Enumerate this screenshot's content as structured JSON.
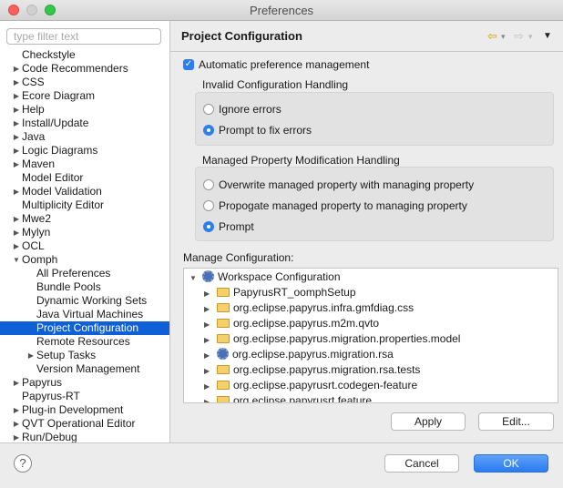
{
  "window": {
    "title": "Preferences"
  },
  "filter": {
    "placeholder": "type filter text",
    "value": ""
  },
  "tree": [
    {
      "label": "Checkstyle",
      "expandable": false,
      "level": 0
    },
    {
      "label": "Code Recommenders",
      "expandable": true,
      "level": 0
    },
    {
      "label": "CSS",
      "expandable": true,
      "level": 0
    },
    {
      "label": "Ecore Diagram",
      "expandable": true,
      "level": 0
    },
    {
      "label": "Help",
      "expandable": true,
      "level": 0
    },
    {
      "label": "Install/Update",
      "expandable": true,
      "level": 0
    },
    {
      "label": "Java",
      "expandable": true,
      "level": 0
    },
    {
      "label": "Logic Diagrams",
      "expandable": true,
      "level": 0
    },
    {
      "label": "Maven",
      "expandable": true,
      "level": 0
    },
    {
      "label": "Model Editor",
      "expandable": false,
      "level": 0
    },
    {
      "label": "Model Validation",
      "expandable": true,
      "level": 0
    },
    {
      "label": "Multiplicity Editor",
      "expandable": false,
      "level": 0
    },
    {
      "label": "Mwe2",
      "expandable": true,
      "level": 0
    },
    {
      "label": "Mylyn",
      "expandable": true,
      "level": 0
    },
    {
      "label": "OCL",
      "expandable": true,
      "level": 0
    },
    {
      "label": "Oomph",
      "expandable": true,
      "expanded": true,
      "level": 0
    },
    {
      "label": "All Preferences",
      "expandable": false,
      "level": 1
    },
    {
      "label": "Bundle Pools",
      "expandable": false,
      "level": 1
    },
    {
      "label": "Dynamic Working Sets",
      "expandable": false,
      "level": 1
    },
    {
      "label": "Java Virtual Machines",
      "expandable": false,
      "level": 1
    },
    {
      "label": "Project Configuration",
      "expandable": false,
      "level": 1,
      "selected": true
    },
    {
      "label": "Remote Resources",
      "expandable": false,
      "level": 1
    },
    {
      "label": "Setup Tasks",
      "expandable": true,
      "level": 1
    },
    {
      "label": "Version Management",
      "expandable": false,
      "level": 1
    },
    {
      "label": "Papyrus",
      "expandable": true,
      "level": 0
    },
    {
      "label": "Papyrus-RT",
      "expandable": false,
      "level": 0
    },
    {
      "label": "Plug-in Development",
      "expandable": true,
      "level": 0
    },
    {
      "label": "QVT Operational Editor",
      "expandable": true,
      "level": 0
    },
    {
      "label": "Run/Debug",
      "expandable": true,
      "level": 0
    }
  ],
  "page": {
    "title": "Project Configuration",
    "nav": {
      "back": "⇦",
      "forward": "⇨",
      "menu": "▼",
      "dropdown": "▾"
    },
    "auto_pref": {
      "label": "Automatic preference management",
      "checked": true,
      "check_glyph": "✓"
    },
    "invalid_group": {
      "title": "Invalid Configuration Handling",
      "options": [
        {
          "label": "Ignore errors",
          "selected": false
        },
        {
          "label": "Prompt to fix errors",
          "selected": true
        }
      ]
    },
    "managed_group": {
      "title": "Managed Property Modification Handling",
      "options": [
        {
          "label": "Overwrite managed property with managing property",
          "selected": false
        },
        {
          "label": "Propogate managed property to managing property",
          "selected": false
        },
        {
          "label": "Prompt",
          "selected": true
        }
      ]
    },
    "manage_config": {
      "label": "Manage Configuration:",
      "root": {
        "label": "Workspace Configuration",
        "icon": "workspace-config-icon",
        "expanded": true
      },
      "items": [
        {
          "label": "PapyrusRT_oomphSetup",
          "icon": "folder-icon"
        },
        {
          "label": "org.eclipse.papyrus.infra.gmfdiag.css",
          "icon": "project-folder-icon"
        },
        {
          "label": "org.eclipse.papyrus.m2m.qvto",
          "icon": "project-folder-icon"
        },
        {
          "label": "org.eclipse.papyrus.migration.properties.model",
          "icon": "project-folder-icon"
        },
        {
          "label": "org.eclipse.papyrus.migration.rsa",
          "icon": "plugin-project-icon"
        },
        {
          "label": "org.eclipse.papyrus.migration.rsa.tests",
          "icon": "project-folder-icon"
        },
        {
          "label": "org.eclipse.papyrusrt.codegen-feature",
          "icon": "project-folder-icon"
        },
        {
          "label": "org.eclipse.papyrusrt.feature",
          "icon": "project-folder-icon"
        }
      ],
      "apply": "Apply",
      "edit": "Edit..."
    }
  },
  "footer": {
    "help": "?",
    "cancel": "Cancel",
    "ok": "OK"
  },
  "colors": {
    "accent": "#2b7ef3",
    "selection": "#0f5fd6",
    "folder": "#f3d06a"
  }
}
